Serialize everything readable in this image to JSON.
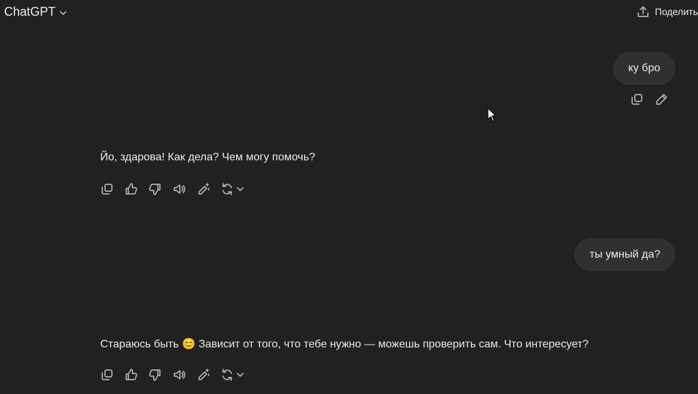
{
  "header": {
    "model_name": "ChatGPT",
    "share_label": "Поделить"
  },
  "conversation": {
    "messages": [
      {
        "role": "user",
        "text": "ку бро"
      },
      {
        "role": "assistant",
        "text": "Йо, здарова! Как дела? Чем могу помочь?"
      },
      {
        "role": "user",
        "text": "ты умный да?"
      },
      {
        "role": "assistant",
        "text": "Стараюсь быть 😊 Зависит от того, что тебе нужно — можешь проверить сам. Что интересует?"
      }
    ]
  },
  "icons": {
    "copy": "copy-icon",
    "edit": "pencil-icon",
    "like": "thumbs-up-icon",
    "dislike": "thumbs-down-icon",
    "read_aloud": "speaker-icon",
    "canvas_edit": "magic-pencil-icon",
    "regenerate": "refresh-icon"
  }
}
